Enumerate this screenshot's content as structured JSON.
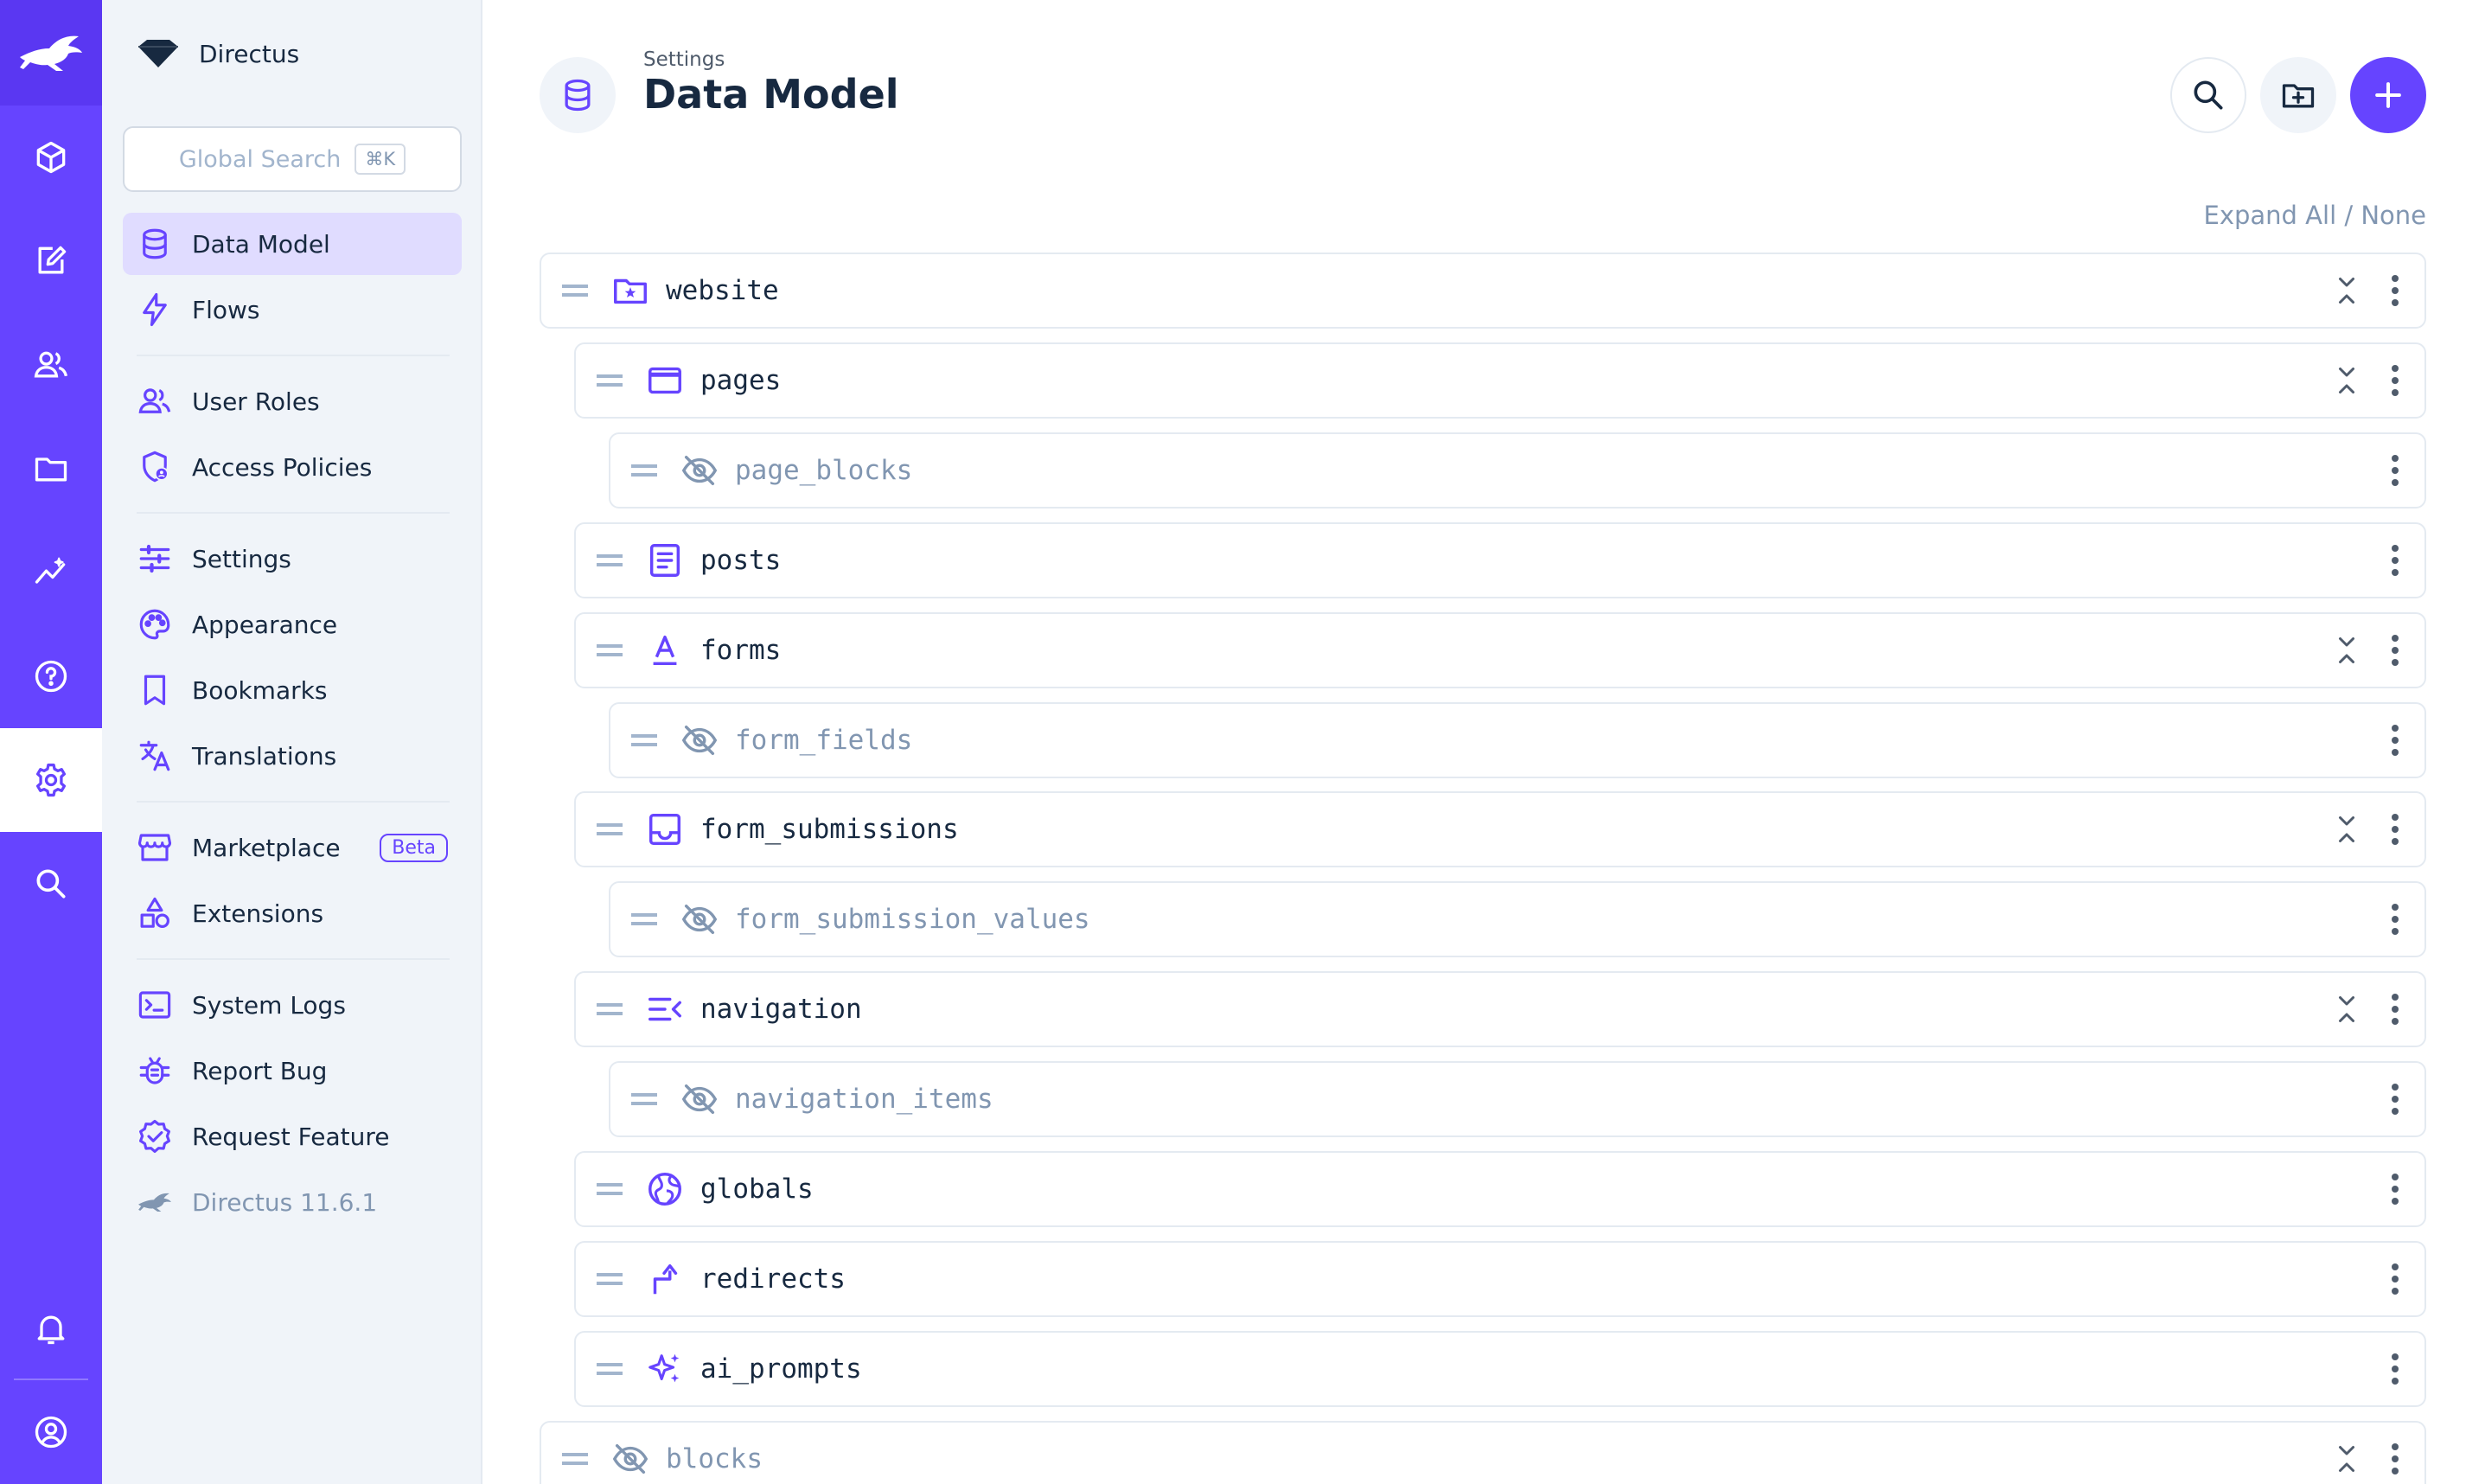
{
  "colors": {
    "accent": "#6644ff",
    "accent_soft": "#e0dcff",
    "text": "#172940",
    "muted": "#8196b1"
  },
  "rail": {
    "items": [
      {
        "icon": "box-icon"
      },
      {
        "icon": "edit-icon"
      },
      {
        "icon": "users-icon"
      },
      {
        "icon": "folder-icon"
      },
      {
        "icon": "insights-icon"
      },
      {
        "icon": "help-icon"
      },
      {
        "icon": "settings-gear-icon"
      },
      {
        "icon": "search-icon"
      },
      {
        "icon": "bell-icon"
      },
      {
        "icon": "account-icon"
      }
    ],
    "active": "settings-gear-icon"
  },
  "nav": {
    "project_name": "Directus",
    "search": {
      "placeholder": "Global Search",
      "shortcut": "⌘K"
    },
    "items": [
      {
        "label": "Data Model",
        "icon": "database-icon",
        "active": true
      },
      {
        "label": "Flows",
        "icon": "bolt-icon"
      },
      {
        "label": "User Roles",
        "icon": "group-icon"
      },
      {
        "label": "Access Policies",
        "icon": "shield-person-icon"
      },
      {
        "label": "Settings",
        "icon": "tune-icon"
      },
      {
        "label": "Appearance",
        "icon": "palette-icon"
      },
      {
        "label": "Bookmarks",
        "icon": "bookmark-icon"
      },
      {
        "label": "Translations",
        "icon": "translate-icon"
      },
      {
        "label": "Marketplace",
        "icon": "storefront-icon",
        "badge": "Beta"
      },
      {
        "label": "Extensions",
        "icon": "category-icon"
      },
      {
        "label": "System Logs",
        "icon": "terminal-icon"
      },
      {
        "label": "Report Bug",
        "icon": "bug-icon"
      },
      {
        "label": "Request Feature",
        "icon": "verified-icon"
      },
      {
        "label": "Directus 11.6.1",
        "icon": "directus-rabbit-icon",
        "muted": true
      }
    ]
  },
  "header": {
    "breadcrumb": "Settings",
    "title": "Data Model",
    "actions": [
      "search-icon",
      "create-folder-icon",
      "add-icon"
    ]
  },
  "expand_all": "Expand All / None",
  "collections": [
    {
      "name": "website",
      "icon": "folder-star-icon",
      "level": 0,
      "hidden": false,
      "collapsible": true
    },
    {
      "name": "pages",
      "icon": "web-window-icon",
      "level": 1,
      "hidden": false,
      "collapsible": true
    },
    {
      "name": "page_blocks",
      "icon": "visibility-off-icon",
      "level": 2,
      "hidden": true,
      "collapsible": false
    },
    {
      "name": "posts",
      "icon": "article-icon",
      "level": 1,
      "hidden": false,
      "collapsible": false
    },
    {
      "name": "forms",
      "icon": "format-text-icon",
      "level": 1,
      "hidden": false,
      "collapsible": true
    },
    {
      "name": "form_fields",
      "icon": "visibility-off-icon",
      "level": 2,
      "hidden": true,
      "collapsible": false
    },
    {
      "name": "form_submissions",
      "icon": "inbox-icon",
      "level": 1,
      "hidden": false,
      "collapsible": true
    },
    {
      "name": "form_submission_values",
      "icon": "visibility-off-icon",
      "level": 2,
      "hidden": true,
      "collapsible": false
    },
    {
      "name": "navigation",
      "icon": "menu-open-icon",
      "level": 1,
      "hidden": false,
      "collapsible": true
    },
    {
      "name": "navigation_items",
      "icon": "visibility-off-icon",
      "level": 2,
      "hidden": true,
      "collapsible": false
    },
    {
      "name": "globals",
      "icon": "globe-icon",
      "level": 1,
      "hidden": false,
      "collapsible": false
    },
    {
      "name": "redirects",
      "icon": "turn-right-icon",
      "level": 1,
      "hidden": false,
      "collapsible": false
    },
    {
      "name": "ai_prompts",
      "icon": "sparkles-icon",
      "level": 1,
      "hidden": false,
      "collapsible": false
    },
    {
      "name": "blocks",
      "icon": "visibility-off-icon",
      "level": 0,
      "hidden": true,
      "collapsible": true
    }
  ]
}
